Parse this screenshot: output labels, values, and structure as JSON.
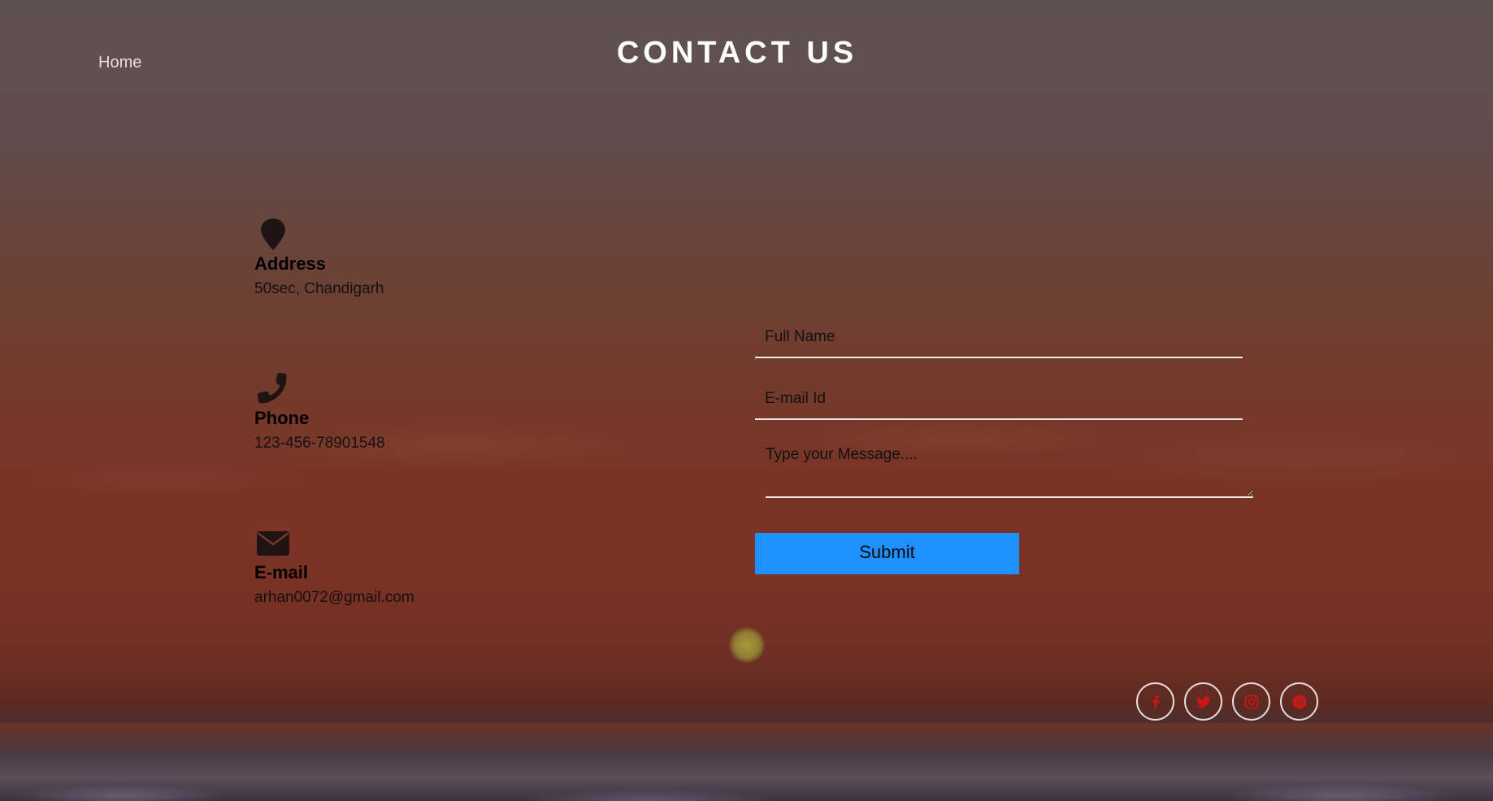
{
  "nav": {
    "home_label": "Home"
  },
  "header": {
    "title": "CONTACT US"
  },
  "contact_info": {
    "address": {
      "icon": "map-pin-icon",
      "label": "Address",
      "value": "50sec, Chandigarh"
    },
    "phone": {
      "icon": "phone-icon",
      "label": "Phone",
      "value": "123-456-78901548"
    },
    "email": {
      "icon": "envelope-icon",
      "label": "E-mail",
      "value": "arhan0072@gmail.com"
    }
  },
  "form": {
    "full_name_placeholder": "Full Name",
    "email_placeholder": "E-mail Id",
    "message_placeholder": "Type your Message....",
    "submit_label": "Submit"
  },
  "social": [
    {
      "icon": "facebook-icon"
    },
    {
      "icon": "twitter-icon"
    },
    {
      "icon": "instagram-icon"
    },
    {
      "icon": "pinterest-icon"
    }
  ],
  "colors": {
    "submit_bg": "#1e90ff",
    "social_icon": "#d01515",
    "title": "#ffffff"
  }
}
